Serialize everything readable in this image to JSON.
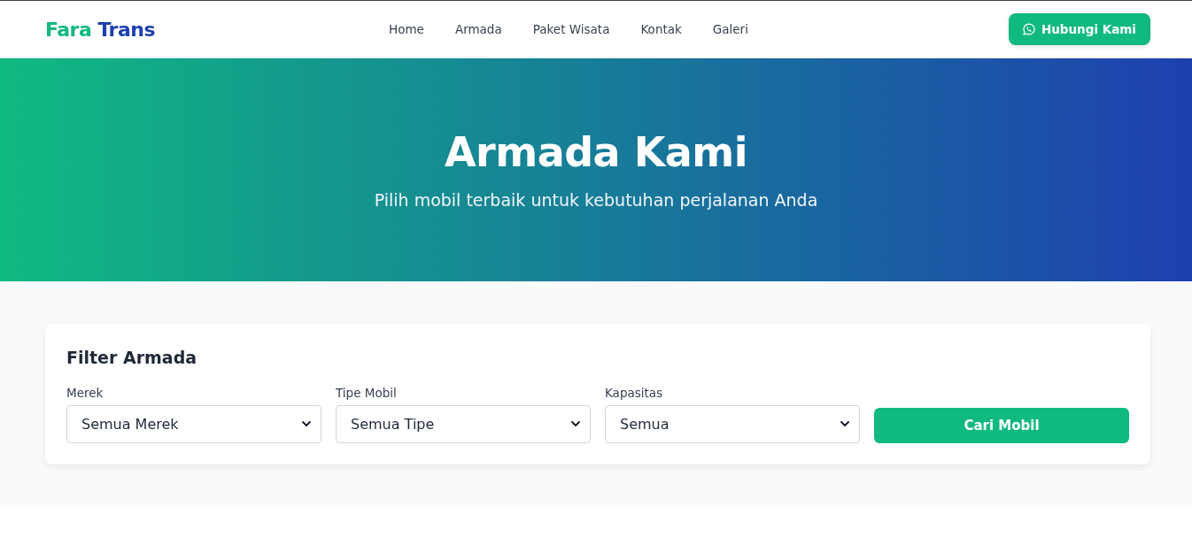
{
  "brand": {
    "first": "Fara",
    "second": "Trans"
  },
  "nav": {
    "links": [
      {
        "label": "Home"
      },
      {
        "label": "Armada"
      },
      {
        "label": "Paket Wisata"
      },
      {
        "label": "Kontak"
      },
      {
        "label": "Galeri"
      }
    ],
    "cta": "Hubungi Kami"
  },
  "hero": {
    "title": "Armada Kami",
    "subtitle": "Pilih mobil terbaik untuk kebutuhan perjalanan Anda"
  },
  "filter": {
    "title": "Filter Armada",
    "fields": [
      {
        "label": "Merek",
        "value": "Semua Merek"
      },
      {
        "label": "Tipe Mobil",
        "value": "Semua Tipe"
      },
      {
        "label": "Kapasitas",
        "value": "Semua"
      }
    ],
    "submit": "Cari Mobil"
  }
}
